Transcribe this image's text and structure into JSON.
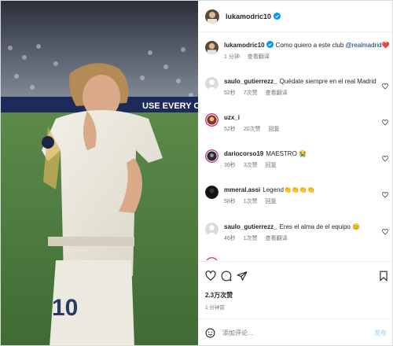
{
  "post": {
    "author": "lukamodric10",
    "verified": true,
    "caption_text": "Como quiero a este club ",
    "caption_mention": "@realmadrid",
    "caption_emoji": "❤️",
    "caption_time": "1 分钟",
    "caption_translate": "查看翻译"
  },
  "comments": [
    {
      "user": "saulo_gutierrezz_",
      "text": "Quédate siempre en el real Madrid",
      "time": "52秒",
      "likes": "7次赞",
      "action": "查看翻译"
    },
    {
      "user": "uzx_i",
      "text": "",
      "time": "52秒",
      "likes": "20次赞",
      "action": "回复"
    },
    {
      "user": "dariocorso19",
      "text": "MAESTRO 😭",
      "time": "39秒",
      "likes": "3次赞",
      "action": "回复"
    },
    {
      "user": "mmeral.assi",
      "text": "Legend👏👏👏👏",
      "time": "58秒",
      "likes": "1次赞",
      "action": "回复"
    },
    {
      "user": "saulo_gutierrezz_",
      "text": "Eres el alma de el equipo 😊",
      "time": "46秒",
      "likes": "1次赞",
      "action": "查看翻译"
    }
  ],
  "footer": {
    "likes": "2.3万次赞",
    "time": "1 分钟前",
    "add_comment_placeholder": "添加评论...",
    "post_label": "发布"
  },
  "icons": {
    "like": "heart-icon",
    "comment": "comment-icon",
    "share": "share-icon",
    "save": "bookmark-icon",
    "emoji": "emoji-icon",
    "verified": "verified-badge-icon"
  },
  "colors": {
    "verified": "#0095f6",
    "mention": "#00376b",
    "post_disabled": "#b2dffc",
    "muted": "#737373"
  }
}
